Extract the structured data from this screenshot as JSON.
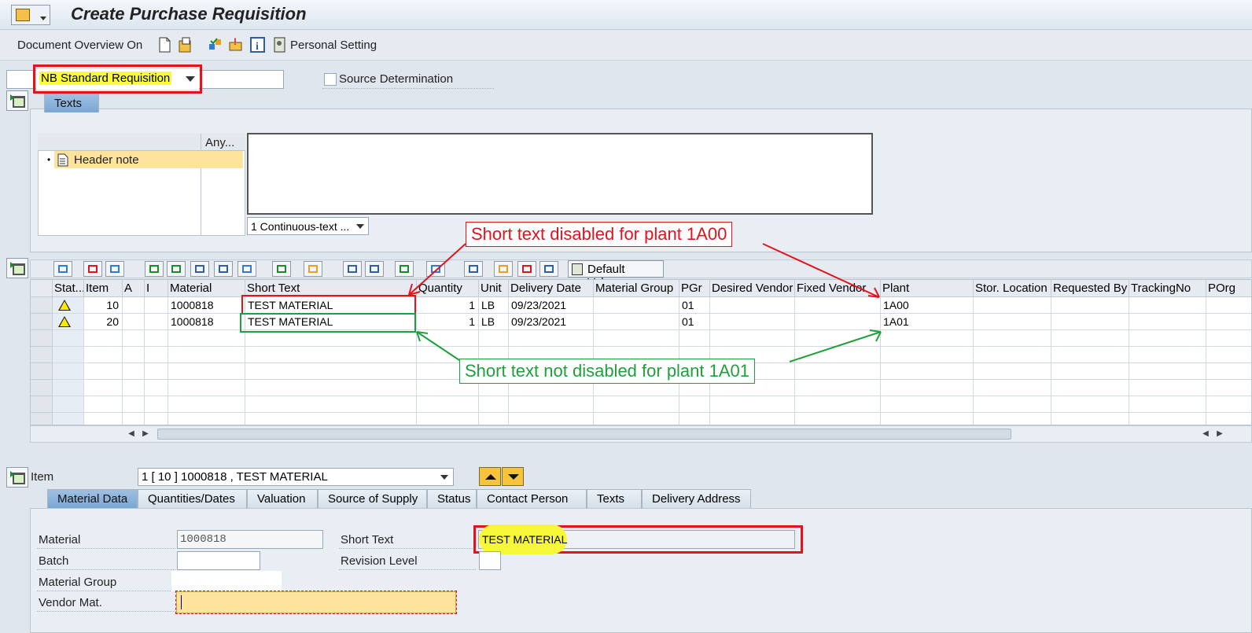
{
  "window": {
    "title": "Create Purchase Requisition"
  },
  "toolbar": {
    "document_overview": "Document Overview On",
    "personal_setting": "Personal Setting"
  },
  "header": {
    "doc_type": "NB Standard Requisition",
    "source_determination": "Source Determination",
    "source_determination_checked": false
  },
  "texts_tab": {
    "tab_label": "Texts",
    "tree_col": "Any...",
    "tree_item": "Header note",
    "format_select": "1 Continuous-text ..."
  },
  "grid": {
    "default_values": "Default Values",
    "columns": [
      "Stat...",
      "Item",
      "A",
      "I",
      "Material",
      "Short Text",
      "Quantity",
      "Unit",
      "Delivery Date",
      "Material Group",
      "PGr",
      "Desired Vendor",
      "Fixed Vendor",
      "Plant",
      "Stor. Location",
      "Requested By",
      "TrackingNo",
      "POrg"
    ],
    "rows": [
      {
        "status": "warning",
        "item": "10",
        "material": "1000818",
        "short_text": "TEST MATERIAL",
        "quantity": "1",
        "unit": "LB",
        "delivery_date": "09/23/2021",
        "pgr": "01",
        "plant": "1A00"
      },
      {
        "status": "warning",
        "item": "20",
        "material": "1000818",
        "short_text": "TEST MATERIAL",
        "quantity": "1",
        "unit": "LB",
        "delivery_date": "09/23/2021",
        "pgr": "01",
        "plant": "1A01"
      }
    ]
  },
  "annotations": {
    "red": "Short text disabled for plant 1A00",
    "green": "Short text not disabled for plant 1A01",
    "red_color": "#e0141e",
    "green_color": "#1ea03c"
  },
  "item_section": {
    "label": "Item",
    "selector": "1 [ 10 ] 1000818 , TEST MATERIAL",
    "tabs": [
      "Material Data",
      "Quantities/Dates",
      "Valuation",
      "Source of Supply",
      "Status",
      "Contact Person",
      "Texts",
      "Delivery Address"
    ],
    "active_tab": "Material Data"
  },
  "material_data": {
    "material_label": "Material",
    "material_value": "1000818",
    "batch_label": "Batch",
    "batch_value": "",
    "material_group_label": "Material Group",
    "vendor_mat_label": "Vendor Mat.",
    "vendor_mat_value": "",
    "short_text_label": "Short Text",
    "short_text_value": "TEST MATERIAL",
    "revision_level_label": "Revision Level",
    "revision_level_value": ""
  },
  "icons": [
    "app-menu-icon",
    "new-document-icon",
    "hold-icon",
    "check-icon",
    "messages-icon",
    "info-icon",
    "personal-setting-icon",
    "warning-icon",
    "expand-icon"
  ]
}
